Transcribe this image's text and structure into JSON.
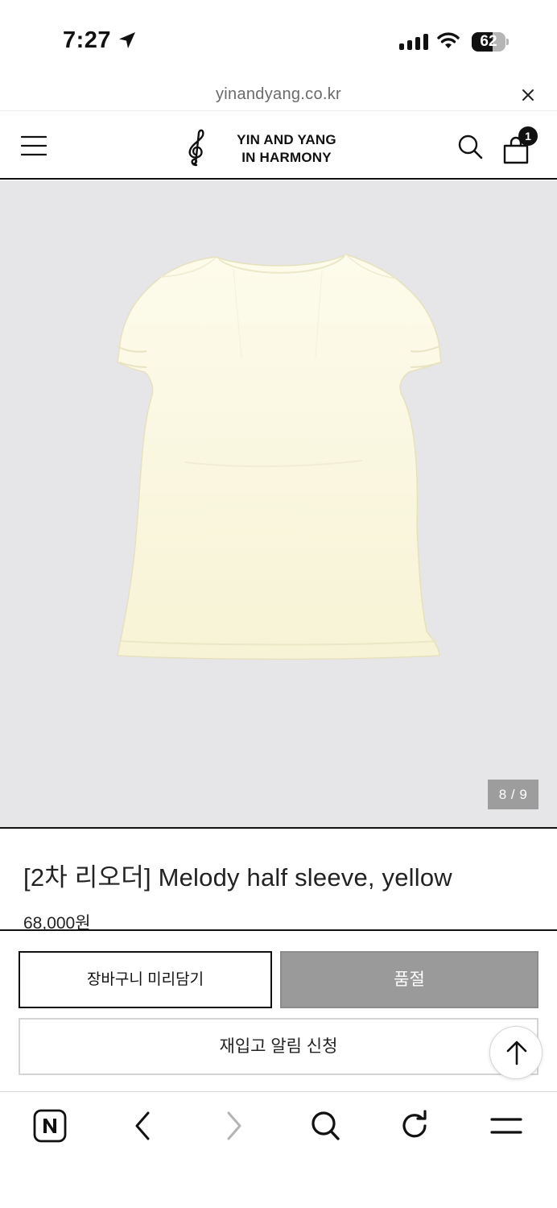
{
  "status_bar": {
    "time": "7:27",
    "battery": "62",
    "battery_level": 0.62
  },
  "browser": {
    "url": "yinandyang.co.kr"
  },
  "header": {
    "logo_line1": "YIN AND YANG",
    "logo_line2": "IN HARMONY",
    "cart_count": "1"
  },
  "gallery": {
    "counter": "8 / 9",
    "current_index": 8,
    "total": 9
  },
  "product": {
    "title": "[2차 리오더] Melody half sleeve, yellow",
    "price": "68,000원"
  },
  "actions": {
    "add_to_cart_label": "장바구니 미리담기",
    "sold_out_label": "품절",
    "restock_alert_label": "재입고 알림 신청"
  },
  "icons": {
    "menu": "hamburger-icon",
    "logo": "treble-clef-icon",
    "search": "search-icon",
    "cart": "shopping-bag-icon",
    "close": "close-icon",
    "scroll_top": "arrow-up-icon",
    "home": "naver-n-icon",
    "back": "chevron-left-icon",
    "forward": "chevron-right-icon",
    "browser_search": "search-icon",
    "reload": "reload-icon",
    "browser_menu": "menu-icon"
  },
  "colors": {
    "accent": "#111111",
    "sold_out": "#9a9a9a",
    "image_background": "#e6e6e8",
    "shirt": "#fbf8e4"
  }
}
